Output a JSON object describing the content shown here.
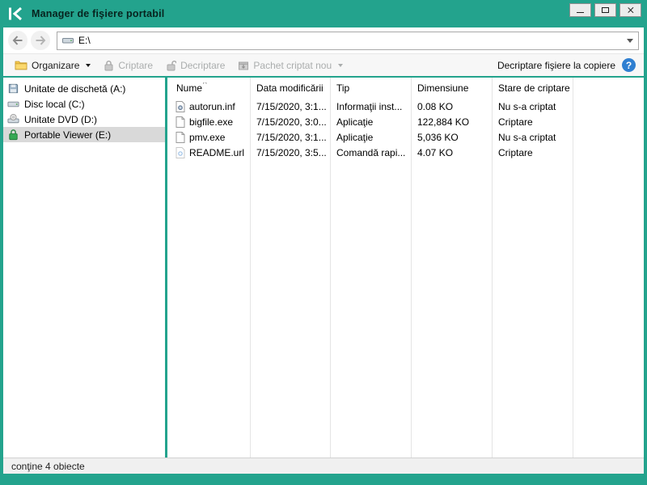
{
  "window": {
    "title": "Manager de fişiere portabil"
  },
  "address_bar": {
    "value": "E:\\"
  },
  "toolbar": {
    "organize_label": "Organizare",
    "encrypt_label": "Criptare",
    "decrypt_label": "Decriptare",
    "new_package_label": "Pachet criptat nou",
    "decrypt_on_copy_label": "Decriptare fişiere la copiere",
    "help_glyph": "?"
  },
  "sidebar": {
    "items": [
      {
        "label": "Unitate de dischetă (A:)",
        "icon": "floppy-icon",
        "selected": false
      },
      {
        "label": "Disc local (C:)",
        "icon": "hdd-icon",
        "selected": false
      },
      {
        "label": "Unitate DVD (D:)",
        "icon": "dvd-icon",
        "selected": false
      },
      {
        "label": "Portable Viewer (E:)",
        "icon": "green-lock-icon",
        "selected": true
      }
    ]
  },
  "file_list": {
    "columns": [
      "Nume",
      "Data modificării",
      "Tip",
      "Dimensiune",
      "Stare de criptare"
    ],
    "rows": [
      {
        "name": "autorun.inf",
        "modified": "7/15/2020, 3:1...",
        "type": "Informaţii inst...",
        "size": "0.08 KO",
        "status": "Nu s-a criptat"
      },
      {
        "name": "bigfile.exe",
        "modified": "7/15/2020, 3:0...",
        "type": "Aplicaţie",
        "size": "122,884 KO",
        "status": "Criptare"
      },
      {
        "name": "pmv.exe",
        "modified": "7/15/2020, 3:1...",
        "type": "Aplicaţie",
        "size": "5,036 KO",
        "status": "Nu s-a criptat"
      },
      {
        "name": "README.url",
        "modified": "7/15/2020, 3:5...",
        "type": "Comandă rapi...",
        "size": "4.07 KO",
        "status": "Criptare"
      }
    ]
  },
  "status_bar": {
    "text": "conţine 4 obiecte"
  },
  "colors": {
    "accent": "#23a38d",
    "selection": "#d9d9d9",
    "help_blue": "#2f7fd1",
    "lock_green": "#35a854"
  }
}
